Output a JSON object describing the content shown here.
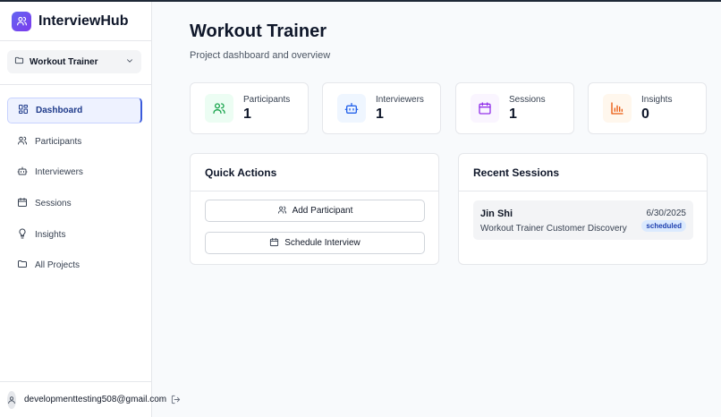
{
  "app": {
    "name": "InterviewHub"
  },
  "project_select": {
    "value": "Workout Trainer"
  },
  "nav": {
    "items": [
      {
        "label": "Dashboard",
        "icon": "dashboard-icon",
        "active": true
      },
      {
        "label": "Participants",
        "icon": "users-icon"
      },
      {
        "label": "Interviewers",
        "icon": "bot-icon"
      },
      {
        "label": "Sessions",
        "icon": "calendar-icon"
      },
      {
        "label": "Insights",
        "icon": "lightbulb-icon"
      },
      {
        "label": "All Projects",
        "icon": "folder-icon"
      }
    ]
  },
  "user": {
    "email": "developmenttesting508@gmail.com"
  },
  "header": {
    "title": "Workout Trainer",
    "subtitle": "Project dashboard and overview"
  },
  "stats": [
    {
      "label": "Participants",
      "value": "1",
      "icon": "users-icon",
      "color": "#16a34a",
      "bg": "#ecfdf3"
    },
    {
      "label": "Interviewers",
      "value": "1",
      "icon": "bot-icon",
      "color": "#2563eb",
      "bg": "#eff6ff"
    },
    {
      "label": "Sessions",
      "value": "1",
      "icon": "calendar-icon",
      "color": "#9333ea",
      "bg": "#faf5ff"
    },
    {
      "label": "Insights",
      "value": "0",
      "icon": "bar-chart-icon",
      "color": "#ea580c",
      "bg": "#fff7ed"
    }
  ],
  "quick_actions": {
    "title": "Quick Actions",
    "buttons": [
      {
        "label": "Add Participant",
        "icon": "users-icon"
      },
      {
        "label": "Schedule Interview",
        "icon": "calendar-icon"
      }
    ]
  },
  "recent_sessions": {
    "title": "Recent Sessions",
    "items": [
      {
        "name": "Jin Shi",
        "title": "Workout Trainer Customer Discovery",
        "date": "6/30/2025",
        "status": "scheduled"
      }
    ]
  }
}
